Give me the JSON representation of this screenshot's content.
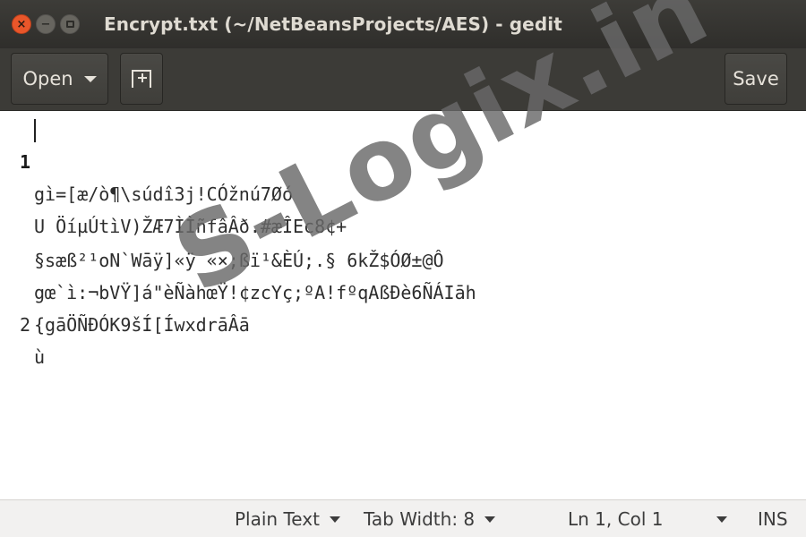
{
  "window": {
    "title": "Encrypt.txt (~/NetBeansProjects/AES) - gedit",
    "close_glyph": "×",
    "minimize_glyph": "−"
  },
  "toolbar": {
    "open_label": "Open",
    "save_label": "Save"
  },
  "editor": {
    "lines": [
      {
        "number": "1",
        "text": "gì=[æ/ò¶\\súdî3j!CÓžnú7Øó"
      },
      {
        "number": "",
        "text": "U ÖíµÚtìV)ŽÆ7ÌÌñfâÂð.#æÎEc8¢+"
      },
      {
        "number": "",
        "text": "§sæß²¹oN`Wāÿ]«ÿ «×;ßï¹&ÈÚ;.§ 6kŽ$ÓØ±@Ô"
      },
      {
        "number": "",
        "text": "gœ`ì:¬bVŸ]á\"èÑàhœŸ!¢zcYç;ºA!fºqAßÐè6ÑÁIāh"
      },
      {
        "number": "",
        "text": "{gāÖÑĐÓK9šÍ[ÍwxdrāÂā"
      },
      {
        "number": "2",
        "text": "ù"
      }
    ]
  },
  "watermark": {
    "text": "S-Logix.in"
  },
  "statusbar": {
    "language": "Plain Text",
    "tab_width": "Tab Width: 8",
    "position": "Ln 1, Col 1",
    "mode": "INS"
  },
  "colors": {
    "titlebar": "#2f2e2b",
    "toolbar": "#3c3b37",
    "close_button": "#e9562a",
    "statusbar": "#f2f1f0"
  }
}
